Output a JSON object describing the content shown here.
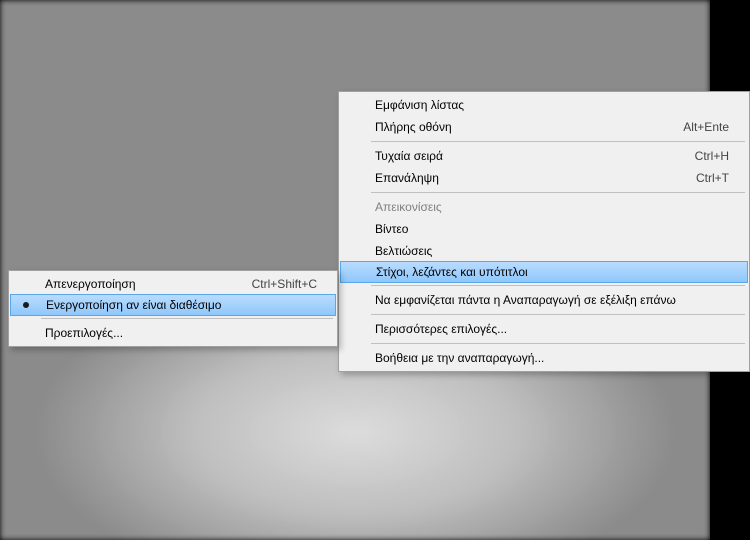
{
  "main_menu": {
    "show_list": "Εμφάνιση λίστας",
    "fullscreen": {
      "label": "Πλήρης οθόνη",
      "shortcut": "Alt+Ente"
    },
    "shuffle": {
      "label": "Τυχαία σειρά",
      "shortcut": "Ctrl+H"
    },
    "repeat": {
      "label": "Επανάληψη",
      "shortcut": "Ctrl+T"
    },
    "visualizations": "Απεικονίσεις",
    "video": "Βίντεο",
    "enhancements": "Βελτιώσεις",
    "lyrics_captions_subtitles": "Στίχοι, λεζάντες και υπότιτλοι",
    "always_show_now_playing": "Να εμφανίζεται πάντα η Αναπαραγωγή σε εξέλιξη επάνω",
    "more_options": "Περισσότερες επιλογές...",
    "help_playback": "Βοήθεια με την αναπαραγωγή..."
  },
  "sub_menu": {
    "off": {
      "label": "Απενεργοποίηση",
      "shortcut": "Ctrl+Shift+C"
    },
    "on_if_available": "Ενεργοποίηση αν είναι διαθέσιμο",
    "defaults": "Προεπιλογές..."
  }
}
